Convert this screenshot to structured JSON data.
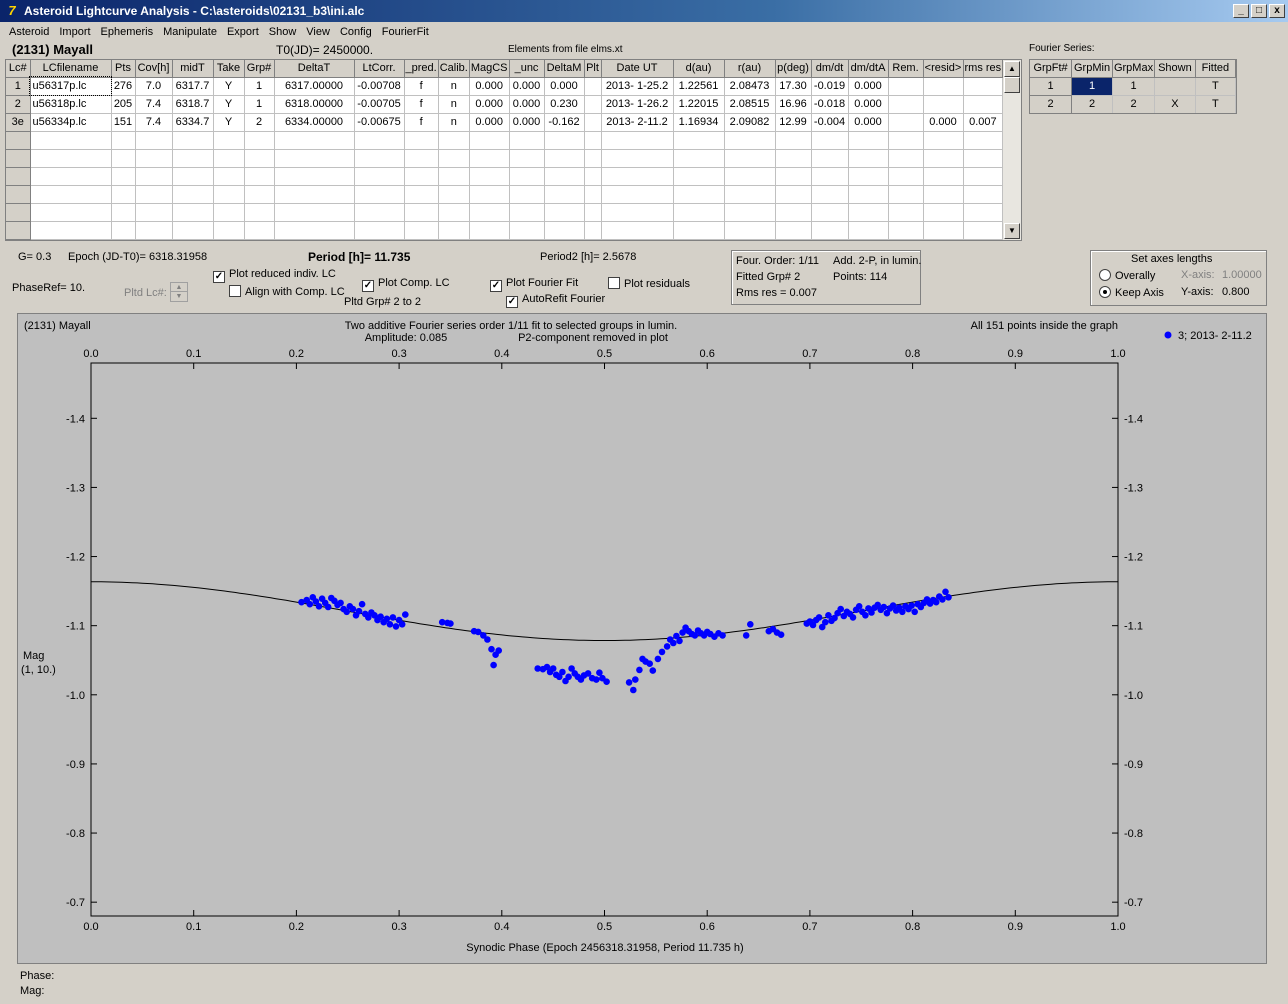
{
  "window": {
    "title": "Asteroid Lightcurve Analysis - C:\\asteroids\\02131_b3\\ini.alc",
    "buttons": [
      "_",
      "□",
      "x"
    ]
  },
  "menu": [
    "Asteroid",
    "Import",
    "Ephemeris",
    "Manipulate",
    "Export",
    "Show",
    "View",
    "Config",
    "FourierFit"
  ],
  "header": {
    "asteroid": "(2131) Mayall",
    "t0": "T0(JD)= 2450000.",
    "elements": "Elements from file elms.xt",
    "fourier_title": "Fourier Series:"
  },
  "lc_table": {
    "headers": [
      "Lc#",
      "LCfilename",
      "Pts",
      "Cov[h]",
      "midT",
      "Take",
      "Grp#",
      "DeltaT",
      "LtCorr.",
      "_pred.",
      "Calib.",
      "MagCS",
      "_unc",
      "DeltaM",
      "Plt",
      "Date UT",
      "d(au)",
      "r(au)",
      "p(deg)",
      "dm/dt",
      "dm/dtA",
      "Rem.",
      "<resid>",
      "rms res"
    ],
    "rows": [
      [
        "1",
        "u56317p.lc",
        "276",
        "7.0",
        "6317.7",
        "Y",
        "1",
        "6317.00000",
        "-0.00708",
        "f",
        "n",
        "0.000",
        "0.000",
        "0.000",
        "",
        "2013- 1-25.2",
        "1.22561",
        "2.08473",
        "17.30",
        "-0.019",
        "0.000",
        "",
        "",
        ""
      ],
      [
        "2",
        "u56318p.lc",
        "205",
        "7.4",
        "6318.7",
        "Y",
        "1",
        "6318.00000",
        "-0.00705",
        "f",
        "n",
        "0.000",
        "0.000",
        "0.230",
        "",
        "2013- 1-26.2",
        "1.22015",
        "2.08515",
        "16.96",
        "-0.018",
        "0.000",
        "",
        "",
        ""
      ],
      [
        "3e",
        "u56334p.lc",
        "151",
        "7.4",
        "6334.7",
        "Y",
        "2",
        "6334.00000",
        "-0.00675",
        "f",
        "n",
        "0.000",
        "0.000",
        "-0.162",
        "",
        "2013- 2-11.2",
        "1.16934",
        "2.09082",
        "12.99",
        "-0.004",
        "0.000",
        "",
        "0.000",
        "0.007"
      ]
    ],
    "empty_rows": 6
  },
  "fourier_table": {
    "headers": [
      "GrpFt#",
      "GrpMin",
      "GrpMax",
      "Shown",
      "Fitted"
    ],
    "rows": [
      [
        "1",
        "1",
        "1",
        "",
        "T"
      ],
      [
        "2",
        "2",
        "2",
        "X",
        "T"
      ]
    ]
  },
  "controls": {
    "g": "G= 0.3",
    "epoch": "Epoch (JD-T0)= 6318.31958",
    "period": "Period [h]= 11.735",
    "period2": "Period2 [h]= 2.5678",
    "phaseref": "PhaseRef= 10.",
    "pltd_lc": "Pltd Lc#:",
    "plot_reduced": "Plot reduced indiv. LC",
    "align_comp": "Align with Comp. LC",
    "plot_comp": "Plot Comp. LC",
    "pltd_grp": "Pltd Grp#  2   to   2",
    "plot_fourier": "Plot Fourier Fit",
    "autorefit": "AutoRefit Fourier",
    "plot_residuals": "Plot residuals",
    "four_order": "Four. Order:  1/11",
    "add_2p": "Add. 2-P, in lumin.",
    "fitted_grp": "Fitted Grp# 2",
    "points": "Points: 114",
    "rms_res": "Rms res     = 0.007",
    "axes_title": "Set axes lengths",
    "overally": "Overally",
    "keep_axis": "Keep Axis",
    "x_axis_label": "X-axis:",
    "x_axis_value": "1.00000",
    "y_axis_label": "Y-axis:",
    "y_axis_value": "0.800",
    "checked_marks": "✓"
  },
  "plot": {
    "asteroid": "(2131) Mayall",
    "subtitle1": "Two additive Fourier series order 1/11 fit to selected groups in lumin.",
    "subtitle2": "Amplitude: 0.085",
    "subtitle3": "P2-component removed in plot",
    "points_note": "All 151 points inside the graph",
    "legend": "3; 2013- 2-11.2",
    "ylabel1": "Mag",
    "ylabel2": "(1, 10.)",
    "xlabel": "Synodic Phase (Epoch 2456318.31958, Period 11.735 h)"
  },
  "status": {
    "phase": "Phase:",
    "mag": "Mag:"
  },
  "chart_data": {
    "type": "scatter",
    "xlim": [
      0.0,
      1.0
    ],
    "ylim": [
      -1.48,
      -0.68
    ],
    "x_ticks": [
      "0.0",
      "0.1",
      "0.2",
      "0.3",
      "0.4",
      "0.5",
      "0.6",
      "0.7",
      "0.8",
      "0.9",
      "1.0"
    ],
    "y_ticks": [
      "-1.4",
      "-1.3",
      "-1.2",
      "-1.1",
      "-1.0",
      "-0.9",
      "-0.8",
      "-0.7"
    ],
    "y_inverted": true,
    "series": [
      {
        "name": "3; 2013- 2-11.2",
        "color": "#0000ff",
        "points": [
          [
            0.205,
            -1.134
          ],
          [
            0.21,
            -1.137
          ],
          [
            0.213,
            -1.131
          ],
          [
            0.216,
            -1.141
          ],
          [
            0.219,
            -1.135
          ],
          [
            0.222,
            -1.128
          ],
          [
            0.225,
            -1.139
          ],
          [
            0.228,
            -1.133
          ],
          [
            0.231,
            -1.127
          ],
          [
            0.234,
            -1.14
          ],
          [
            0.237,
            -1.136
          ],
          [
            0.24,
            -1.13
          ],
          [
            0.243,
            -1.133
          ],
          [
            0.246,
            -1.124
          ],
          [
            0.249,
            -1.12
          ],
          [
            0.252,
            -1.128
          ],
          [
            0.255,
            -1.124
          ],
          [
            0.258,
            -1.115
          ],
          [
            0.261,
            -1.121
          ],
          [
            0.264,
            -1.131
          ],
          [
            0.267,
            -1.117
          ],
          [
            0.27,
            -1.112
          ],
          [
            0.273,
            -1.119
          ],
          [
            0.276,
            -1.115
          ],
          [
            0.279,
            -1.108
          ],
          [
            0.282,
            -1.113
          ],
          [
            0.285,
            -1.105
          ],
          [
            0.288,
            -1.11
          ],
          [
            0.291,
            -1.102
          ],
          [
            0.294,
            -1.112
          ],
          [
            0.297,
            -1.099
          ],
          [
            0.3,
            -1.108
          ],
          [
            0.303,
            -1.102
          ],
          [
            0.306,
            -1.116
          ],
          [
            0.342,
            -1.105
          ],
          [
            0.347,
            -1.104
          ],
          [
            0.35,
            -1.103
          ],
          [
            0.373,
            -1.092
          ],
          [
            0.377,
            -1.091
          ],
          [
            0.382,
            -1.086
          ],
          [
            0.386,
            -1.08
          ],
          [
            0.39,
            -1.066
          ],
          [
            0.394,
            -1.058
          ],
          [
            0.397,
            -1.064
          ],
          [
            0.392,
            -1.043
          ],
          [
            0.435,
            -1.038
          ],
          [
            0.44,
            -1.037
          ],
          [
            0.444,
            -1.04
          ],
          [
            0.447,
            -1.033
          ],
          [
            0.45,
            -1.038
          ],
          [
            0.453,
            -1.029
          ],
          [
            0.456,
            -1.026
          ],
          [
            0.459,
            -1.033
          ],
          [
            0.462,
            -1.02
          ],
          [
            0.465,
            -1.026
          ],
          [
            0.468,
            -1.038
          ],
          [
            0.471,
            -1.031
          ],
          [
            0.474,
            -1.026
          ],
          [
            0.477,
            -1.022
          ],
          [
            0.48,
            -1.028
          ],
          [
            0.484,
            -1.031
          ],
          [
            0.488,
            -1.024
          ],
          [
            0.492,
            -1.022
          ],
          [
            0.495,
            -1.032
          ],
          [
            0.498,
            -1.024
          ],
          [
            0.502,
            -1.019
          ],
          [
            0.524,
            -1.018
          ],
          [
            0.528,
            -1.007
          ],
          [
            0.53,
            -1.022
          ],
          [
            0.534,
            -1.036
          ],
          [
            0.537,
            -1.052
          ],
          [
            0.54,
            -1.048
          ],
          [
            0.544,
            -1.045
          ],
          [
            0.547,
            -1.035
          ],
          [
            0.552,
            -1.052
          ],
          [
            0.556,
            -1.062
          ],
          [
            0.561,
            -1.07
          ],
          [
            0.564,
            -1.08
          ],
          [
            0.567,
            -1.075
          ],
          [
            0.57,
            -1.085
          ],
          [
            0.573,
            -1.078
          ],
          [
            0.576,
            -1.09
          ],
          [
            0.579,
            -1.097
          ],
          [
            0.582,
            -1.092
          ],
          [
            0.585,
            -1.088
          ],
          [
            0.588,
            -1.086
          ],
          [
            0.591,
            -1.093
          ],
          [
            0.594,
            -1.089
          ],
          [
            0.597,
            -1.086
          ],
          [
            0.6,
            -1.091
          ],
          [
            0.603,
            -1.088
          ],
          [
            0.607,
            -1.084
          ],
          [
            0.611,
            -1.089
          ],
          [
            0.615,
            -1.086
          ],
          [
            0.638,
            -1.086
          ],
          [
            0.642,
            -1.102
          ],
          [
            0.66,
            -1.092
          ],
          [
            0.664,
            -1.095
          ],
          [
            0.668,
            -1.09
          ],
          [
            0.672,
            -1.087
          ],
          [
            0.697,
            -1.103
          ],
          [
            0.7,
            -1.106
          ],
          [
            0.703,
            -1.101
          ],
          [
            0.706,
            -1.108
          ],
          [
            0.709,
            -1.112
          ],
          [
            0.712,
            -1.098
          ],
          [
            0.715,
            -1.105
          ],
          [
            0.718,
            -1.115
          ],
          [
            0.721,
            -1.107
          ],
          [
            0.724,
            -1.111
          ],
          [
            0.727,
            -1.118
          ],
          [
            0.73,
            -1.124
          ],
          [
            0.733,
            -1.114
          ],
          [
            0.736,
            -1.12
          ],
          [
            0.739,
            -1.117
          ],
          [
            0.742,
            -1.112
          ],
          [
            0.745,
            -1.123
          ],
          [
            0.748,
            -1.128
          ],
          [
            0.751,
            -1.12
          ],
          [
            0.754,
            -1.115
          ],
          [
            0.757,
            -1.125
          ],
          [
            0.76,
            -1.119
          ],
          [
            0.763,
            -1.126
          ],
          [
            0.766,
            -1.13
          ],
          [
            0.769,
            -1.123
          ],
          [
            0.772,
            -1.127
          ],
          [
            0.775,
            -1.118
          ],
          [
            0.778,
            -1.125
          ],
          [
            0.781,
            -1.129
          ],
          [
            0.784,
            -1.122
          ],
          [
            0.787,
            -1.126
          ],
          [
            0.79,
            -1.12
          ],
          [
            0.793,
            -1.128
          ],
          [
            0.796,
            -1.124
          ],
          [
            0.799,
            -1.129
          ],
          [
            0.802,
            -1.12
          ],
          [
            0.805,
            -1.131
          ],
          [
            0.808,
            -1.127
          ],
          [
            0.811,
            -1.133
          ],
          [
            0.814,
            -1.138
          ],
          [
            0.817,
            -1.132
          ],
          [
            0.82,
            -1.137
          ],
          [
            0.823,
            -1.134
          ],
          [
            0.826,
            -1.142
          ],
          [
            0.829,
            -1.138
          ],
          [
            0.832,
            -1.149
          ],
          [
            0.835,
            -1.141
          ]
        ]
      }
    ],
    "fit_curve": {
      "type": "line",
      "mean": -1.121,
      "amplitude": 0.0425,
      "phase_of_min_brightness": 0.5,
      "note": "fundamental Fourier term, peak near phase 0.0 and 1.0"
    }
  }
}
